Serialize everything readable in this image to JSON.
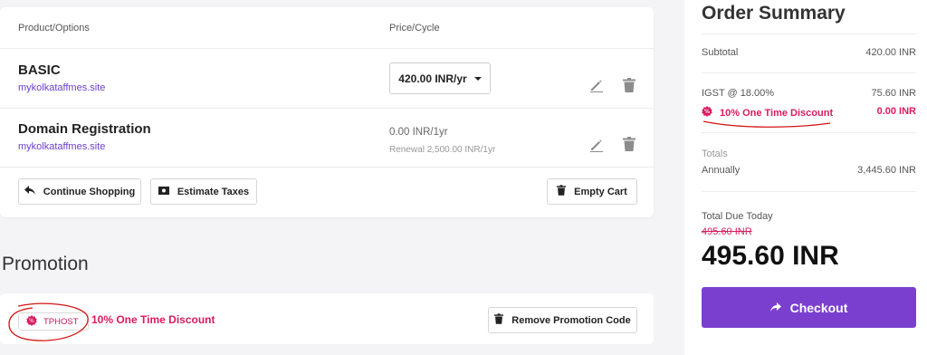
{
  "cart": {
    "header": {
      "product": "Product/Options",
      "price": "Price/Cycle"
    },
    "items": [
      {
        "name": "BASIC",
        "domain": "mykolkataffmes.site",
        "cycle": "420.00 INR/yr"
      },
      {
        "name": "Domain Registration",
        "domain": "mykolkataffmes.site",
        "price": "0.00 INR/1yr",
        "renewal": "Renewal 2,500.00 INR/1yr"
      }
    ],
    "buttons": {
      "continue": "Continue Shopping",
      "taxes": "Estimate Taxes",
      "empty": "Empty Cart"
    }
  },
  "promotion": {
    "heading": "Promotion",
    "code": "TPHOST",
    "description": "10% One Time Discount",
    "remove_label": "Remove Promotion Code"
  },
  "summary": {
    "title": "Order Summary",
    "subtotal_label": "Subtotal",
    "subtotal_value": "420.00 INR",
    "tax_label": "IGST @ 18.00%",
    "tax_value": "75.60 INR",
    "discount_label": "10% One Time Discount",
    "discount_value": "0.00 INR",
    "totals_label": "Totals",
    "annually_label": "Annually",
    "annually_value": "3,445.60 INR",
    "due_label": "Total Due Today",
    "due_strike": "495.60 INR",
    "due_amount": "495.60 INR",
    "checkout_label": "Checkout"
  },
  "colors": {
    "accent": "#7b3fcf",
    "discount": "#d81b60",
    "link": "#6c3fc5",
    "annotation": "#d21414"
  },
  "icons": [
    "edit-icon",
    "trash-icon",
    "back-arrow-icon",
    "money-icon",
    "promo-badge-icon",
    "arrow-right-icon",
    "caret-down-icon"
  ]
}
